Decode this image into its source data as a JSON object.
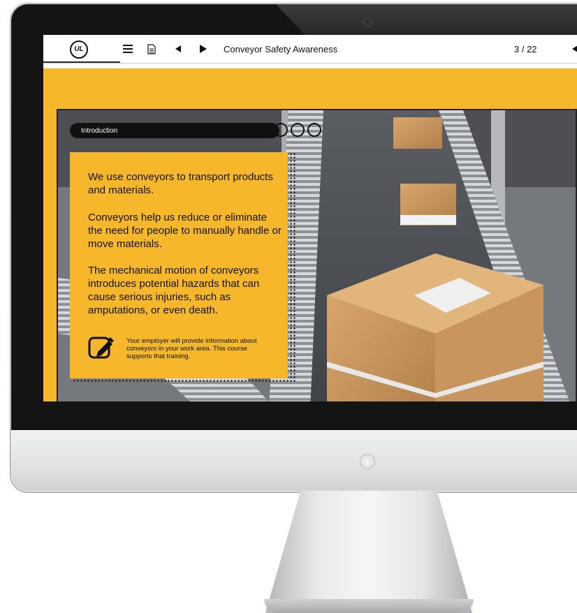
{
  "player": {
    "brand_logo_text": "UL",
    "course_title": "Conveyor Safety Awareness",
    "page_counter": "3 / 22"
  },
  "slide": {
    "section_label": "Introduction",
    "progress": {
      "current_step": 1,
      "total_steps": 4
    },
    "paragraphs": [
      "We use conveyors to transport products and materials.",
      "Conveyors help us reduce or eliminate the need for people to manually handle or move materials.",
      "The mechanical motion of conveyors introduces potential hazards that can cause serious injuries, such as amputations, or even death."
    ],
    "note": "Your employer will provide information about conveyors in your work area. This course supports that training.",
    "accent_color": "#f6b72b"
  }
}
